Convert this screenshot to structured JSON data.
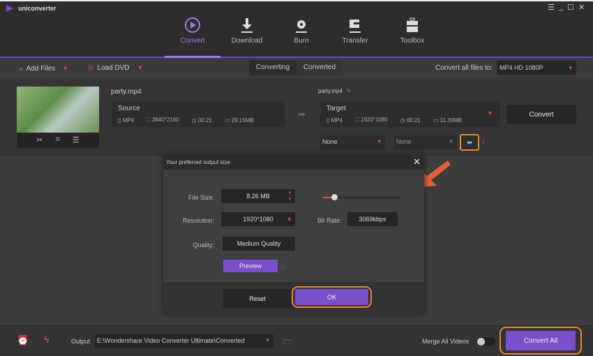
{
  "app": {
    "title": "uniconverter",
    "window_controls": [
      "menu-icon",
      "minimize-icon",
      "maximize-icon",
      "close-icon"
    ]
  },
  "nav": {
    "tabs": [
      {
        "label": "Convert",
        "icon": "convert-icon",
        "active": true
      },
      {
        "label": "Download",
        "icon": "download-icon"
      },
      {
        "label": "Burn",
        "icon": "burn-icon"
      },
      {
        "label": "Transfer",
        "icon": "transfer-icon"
      },
      {
        "label": "Toolbox",
        "icon": "toolbox-icon"
      }
    ]
  },
  "toolbar": {
    "add_files": "Add Files",
    "load_dvd": "Load DVD",
    "segments": [
      "Converting",
      "Converted"
    ],
    "convert_all_label": "Convert all files to:",
    "format": "MP4 HD 1080P"
  },
  "file": {
    "name": "party.mp4",
    "source": {
      "label": "Source",
      "format": "MP4",
      "resolution": "3840*2160",
      "duration": "00:21",
      "size": "29.15MB"
    },
    "target": {
      "name": "party.mp4",
      "label": "Target",
      "format": "MP4",
      "resolution": "1920*1080",
      "duration": "00:21",
      "size": "11.39MB"
    },
    "convert_button": "Convert",
    "subtitle": "None",
    "audio": "None"
  },
  "dialog": {
    "title": "Your preferred output size",
    "file_size_label": "File Size:",
    "file_size": "8.26  MB",
    "slider_percent": 15,
    "resolution_label": "Resolution:",
    "resolution": "1920*1080",
    "bitrate_label": "Bit Rate:",
    "bitrate": "3069kbps",
    "quality_label": "Quality:",
    "quality": "Medium Quality",
    "preview": "Preview",
    "reset": "Reset",
    "ok": "OK"
  },
  "bottom": {
    "output_label": "Output",
    "output_path": "E:\\Wondershare Video Converter Ultimate\\Converted",
    "merge_label": "Merge All Videos",
    "merge_on": false,
    "convert_all": "Convert All"
  },
  "colors": {
    "accent": "#7a4fc9",
    "highlight": "#e8892f",
    "red": "#e0503a"
  }
}
